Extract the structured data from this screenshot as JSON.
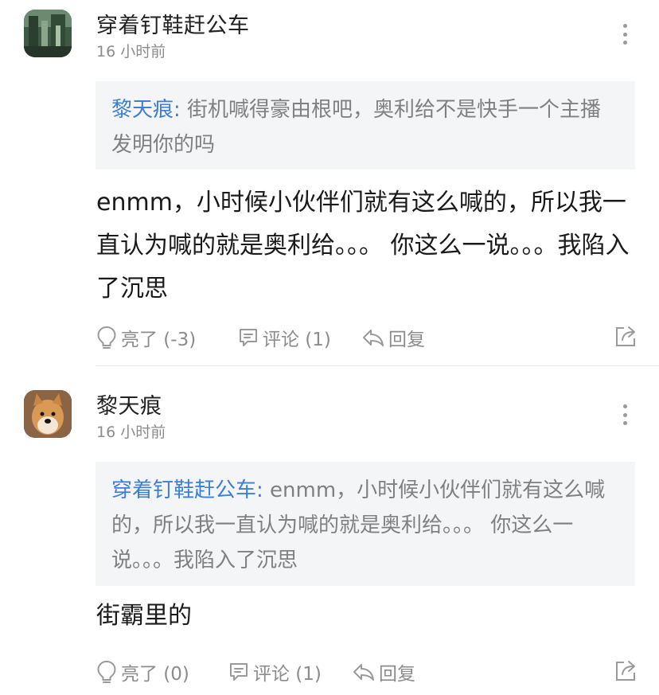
{
  "comments": [
    {
      "username": "穿着钉鞋赶公车",
      "time": "16 小时前",
      "quote_author": "黎天痕:",
      "quote_text": " 街机喊得豪由根吧，奥利给不是快手一个主播发明你的吗",
      "body": "enmm，小时候小伙伴们就有这么喊的，所以我一直认为喊的就是奥利给。。。 你这么一说。。。我陷入了沉思",
      "like_label": "亮了 (-3)",
      "comment_label": "评论 (1)",
      "reply_label": "回复"
    },
    {
      "username": "黎天痕",
      "time": "16 小时前",
      "quote_author": "穿着钉鞋赶公车:",
      "quote_text": " enmm，小时候小伙伴们就有这么喊的，所以我一直认为喊的就是奥利给。。。 你这么一说。。。我陷入了沉思",
      "body": "街霸里的",
      "like_label": "亮了 (0)",
      "comment_label": "评论 (1)",
      "reply_label": "回复"
    }
  ],
  "colors": {
    "quote_author": "#3d7fd6",
    "quote_bg": "#f4f5f7",
    "muted": "#8c8c8c"
  },
  "icons": [
    "more-icon",
    "like-bulb-icon",
    "comment-icon",
    "reply-arrow-icon",
    "share-icon"
  ]
}
